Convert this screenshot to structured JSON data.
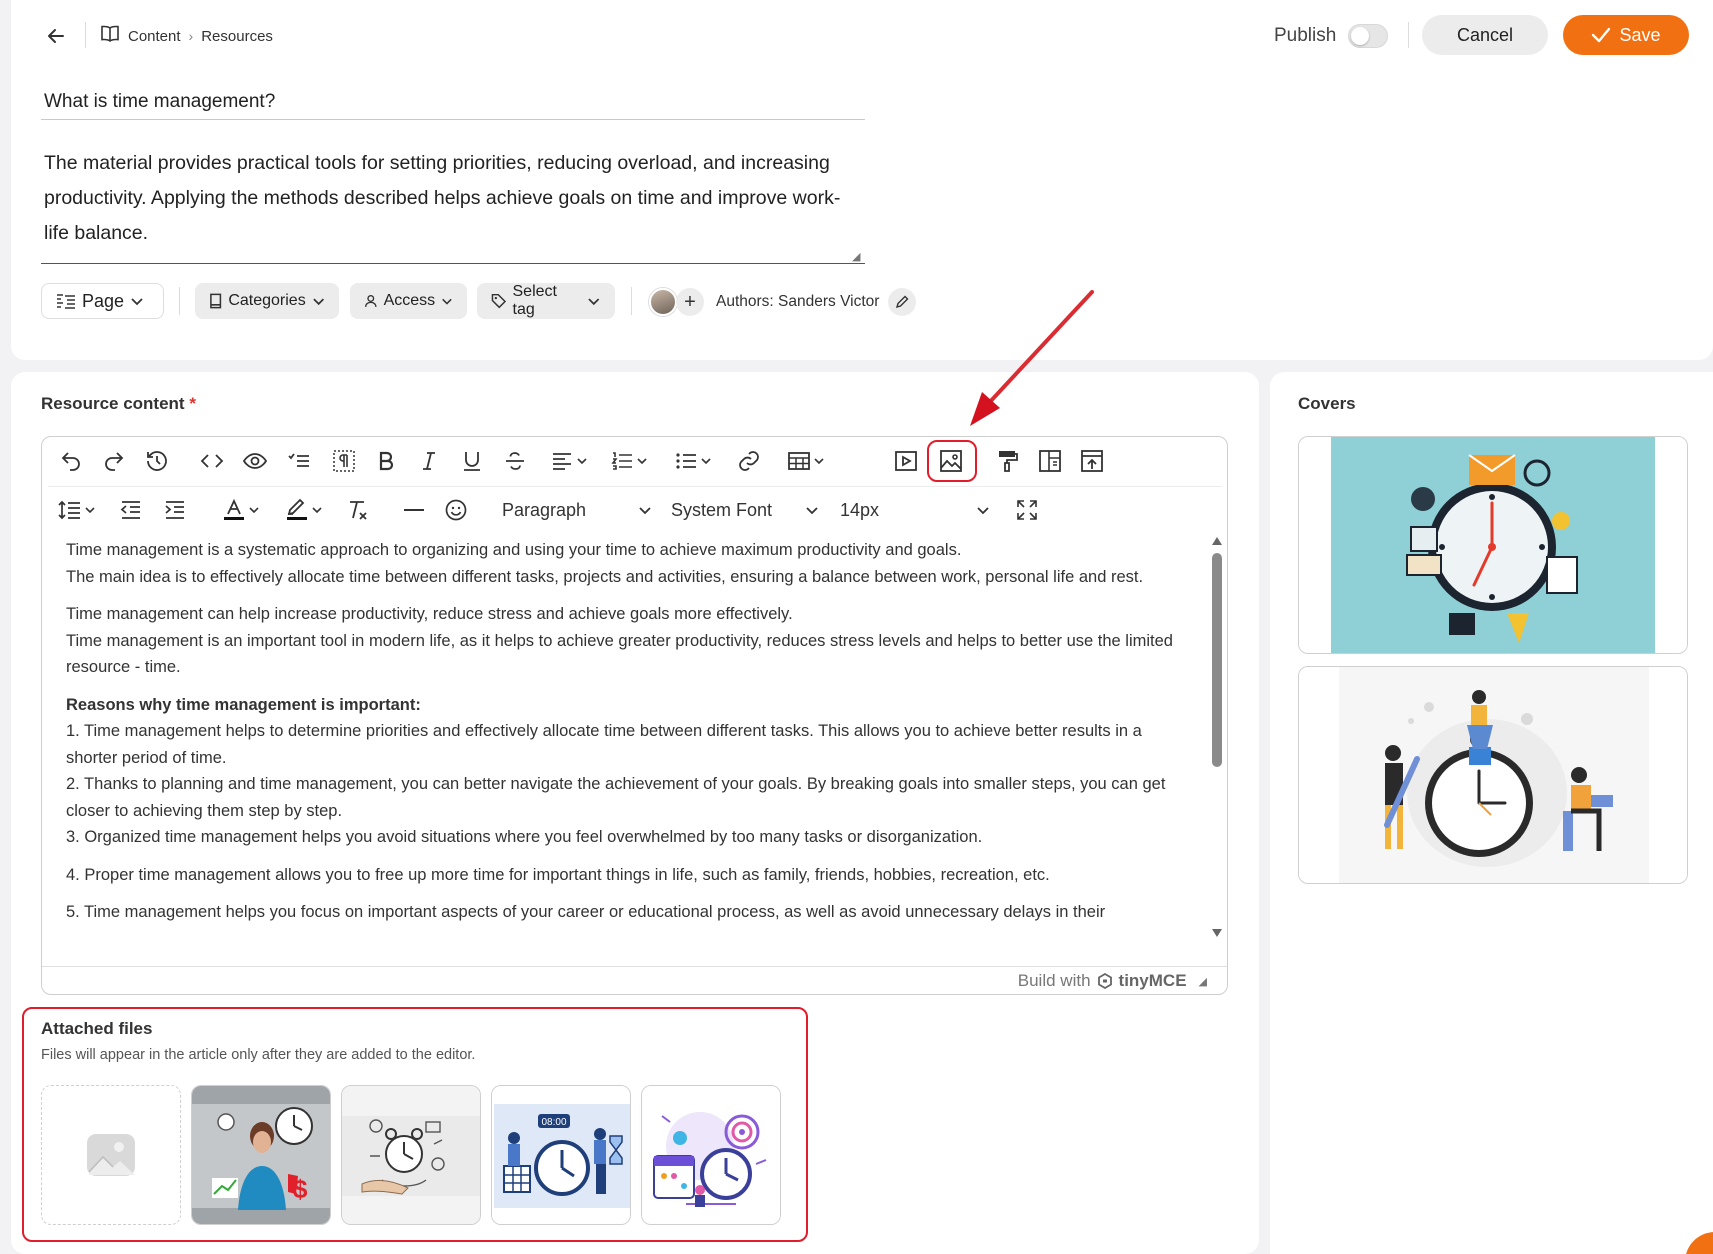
{
  "header": {
    "breadcrumbs": [
      "Content",
      "Resources"
    ],
    "publish_label": "Publish",
    "publish_on": false,
    "cancel_label": "Cancel",
    "save_label": "Save"
  },
  "resource": {
    "title": "What is time management?",
    "description": "The material provides practical tools for setting priorities, reducing overload, and increasing productivity. Applying the methods described helps achieve goals on time and improve work-life balance."
  },
  "meta": {
    "page_label": "Page",
    "categories_label": "Categories",
    "access_label": "Access",
    "tag_label": "Select tag",
    "authors_label": "Authors: Sanders Victor"
  },
  "editor": {
    "section_label": "Resource content",
    "required_mark": "*",
    "block_format": "Paragraph",
    "font_family": "System Font",
    "font_size": "14px",
    "paragraphs": [
      [
        "Time management is a systematic approach to organizing and using your time to achieve maximum productivity and goals.",
        "The main idea is to effectively allocate time between different tasks, projects and activities, ensuring a balance between work, personal life and rest."
      ],
      [
        "Time management can help increase productivity, reduce stress and achieve goals more effectively.",
        "Time management is an important tool in modern life, as it helps to achieve greater productivity, reduces stress levels and helps to better use the limited resource - time."
      ],
      [
        "1. Time management helps to determine priorities and effectively allocate time between different tasks. This allows you to achieve better results in a shorter period of time.",
        "2. Thanks to planning and time management, you can better navigate the achievement of your goals. By breaking goals into smaller steps, you can get closer to achieving them step by step.",
        "3. Organized time management helps you avoid situations where you feel overwhelmed by too many tasks or disorganization."
      ],
      [
        "4. Proper time management allows you to free up more time for important things in life, such as family, friends, hobbies, recreation, etc."
      ],
      [
        "5. Time management helps you focus on important aspects of your career or educational process, as well as avoid unnecessary delays in their"
      ]
    ],
    "reasons_heading": "Reasons why time management is important:",
    "built_with": "Build with",
    "brand": "tinyMCE",
    "highlight_color": "#e11d2b"
  },
  "attached": {
    "title": "Attached files",
    "hint": "Files will appear in the article only after they are added to the editor.",
    "thumb_badge": "08:00"
  },
  "covers": {
    "title": "Covers"
  },
  "colors": {
    "accent": "#f07012",
    "highlight": "#e11d2b"
  }
}
